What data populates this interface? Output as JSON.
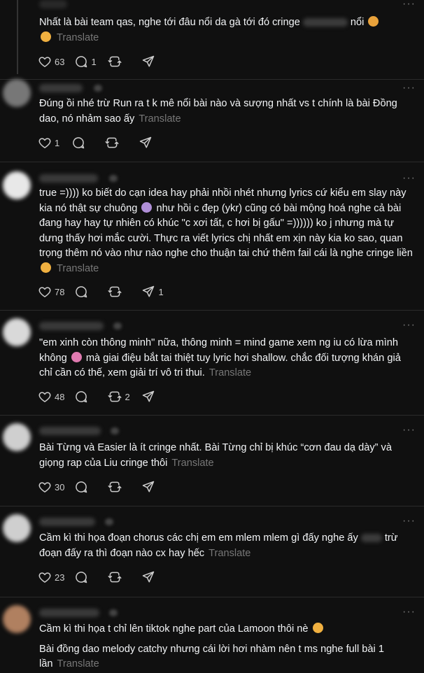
{
  "posts": [
    {
      "text_parts": [
        "Nhất là bài team qas, nghe tới đâu nổi da gà tới đó cringe",
        "nổi"
      ],
      "translate": "Translate",
      "likes": "63",
      "replies": "1",
      "reposts": "",
      "shares": ""
    },
    {
      "text": "Đúng ồi nhé trừ Run ra t k mê nổi bài nào và sượng nhất vs t chính là bài Đồng dao, nó nhảm sao ấy",
      "translate": "Translate",
      "likes": "1",
      "replies": "",
      "reposts": "",
      "shares": ""
    },
    {
      "text_parts": [
        "true =)))) ko biết do cạn idea hay phải nhồi nhét nhưng lyrics cứ kiểu em slay này kia nó thật sự chuông",
        "như hồi c đẹp (ykr) cũng có bài mộng hoá nghe cả bài đang hay hay tự nhiên có khúc \"c xơi tất, c hơi bị gấu\" =)))))) ko j nhưng mà tự dưng thấy hơi mắc cười. Thực ra viết lyrics chị nhất em xịn này kia ko sao, quan trọng thêm nó vào như nào nghe cho thuận tai chứ thêm fail cái là nghe cringe liền"
      ],
      "translate": "Translate",
      "likes": "78",
      "replies": "",
      "reposts": "",
      "shares": "1"
    },
    {
      "text_parts": [
        "\"em xinh còn thông minh\" nữa, thông minh = mind game xem ng iu có lừa mình không",
        "mà giai điệu bắt tai thiệt tuy lyric hơi shallow. chắc đối tượng khán giả chỉ cần có thế, xem giải trí vô tri thui."
      ],
      "translate": "Translate",
      "likes": "48",
      "replies": "",
      "reposts": "2",
      "shares": ""
    },
    {
      "text": "Bài Từng và Easier là ít cringe nhất. Bài Từng chỉ bị khúc “cơn đau dạ dày” và giọng rap của Liu cringe thôi",
      "translate": "Translate",
      "likes": "30",
      "replies": "",
      "reposts": "",
      "shares": ""
    },
    {
      "text_parts": [
        "Cầm kì thi họa đoạn chorus các chị em em mlem mlem gì đấy nghe ấy",
        "trừ đoạn đấy ra thì đoạn nào cx hay hếc"
      ],
      "translate": "Translate",
      "likes": "23",
      "replies": "",
      "reposts": "",
      "shares": ""
    },
    {
      "text": "Cầm kì thi họa t chỉ lên tiktok nghe part của Lamoon thôi nè",
      "text2": "Bài đồng dao melody catchy nhưng cái lời hơi nhàm nên t ms nghe full bài 1 lần",
      "translate": "Translate"
    }
  ],
  "icons": {
    "like": "heart-icon",
    "reply": "comment-icon",
    "repost": "repost-icon",
    "share": "share-icon",
    "more": "more-icon"
  },
  "colors": {
    "background": "#101010",
    "text": "#f3f5f7",
    "muted": "#777777",
    "divider": "#2b2b2b"
  }
}
